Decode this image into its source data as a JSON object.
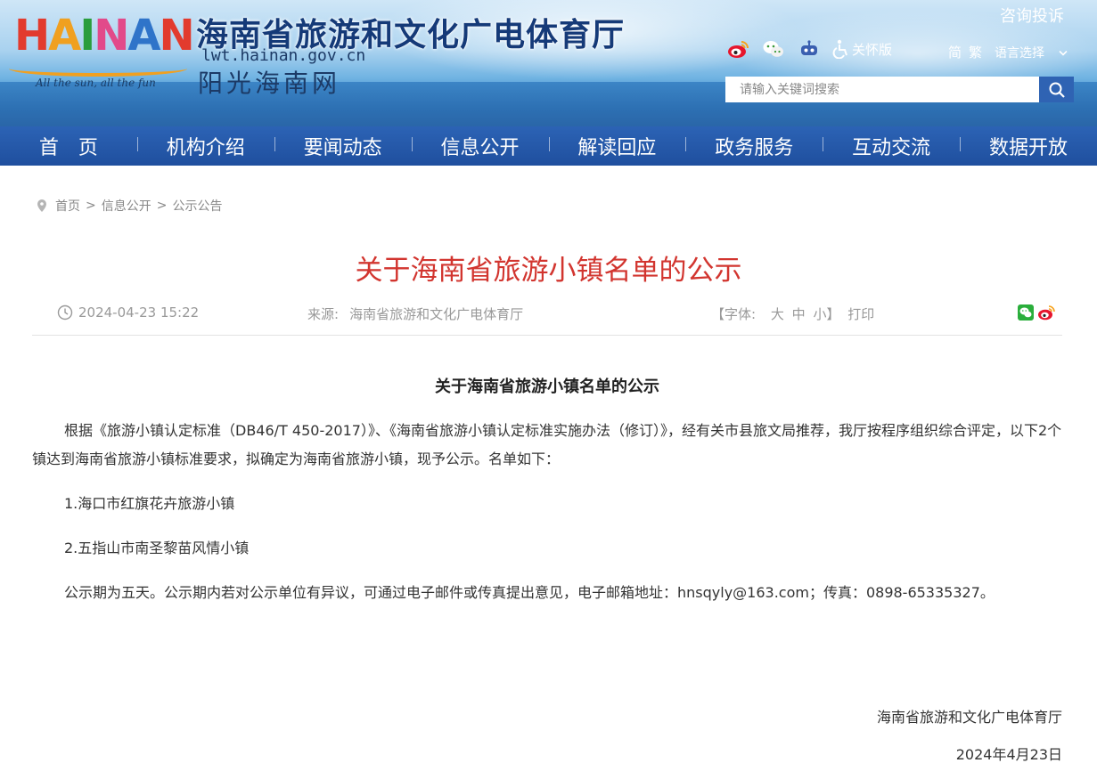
{
  "header": {
    "logo_letters": [
      "H",
      "A",
      "I",
      "N",
      "A",
      "N"
    ],
    "logo_slogan": "All the sun, all the fun",
    "site_title": "海南省旅游和文化广电体育厅",
    "site_domain": "lwt.hainan.gov.cn",
    "site_subtitle": "阳光海南网",
    "consult_link": "咨询投诉",
    "toolbar": {
      "weibo_icon": "weibo-icon",
      "wechat_icon": "wechat-icon",
      "robot_icon": "robot-icon",
      "accessibility_icon": "wheelchair-icon",
      "care_label": "关怀版"
    },
    "lang": {
      "simplified": "简",
      "traditional": "繁",
      "select_label": "语言选择"
    },
    "search": {
      "placeholder": "请输入关键词搜索"
    }
  },
  "nav": {
    "items": [
      "首　页",
      "机构介绍",
      "要闻动态",
      "信息公开",
      "解读回应",
      "政务服务",
      "互动交流",
      "数据开放"
    ]
  },
  "breadcrumb": {
    "items": [
      "首页",
      "信息公开",
      "公示公告"
    ],
    "separator": ">"
  },
  "page_title": "关于海南省旅游小镇名单的公示",
  "meta": {
    "date": "2024-04-23 15:22",
    "source_label": "来源:",
    "source_value": "海南省旅游和文化广电体育厅",
    "font_open": "【字体:",
    "font_large": "大",
    "font_medium": "中",
    "font_small": "小】",
    "print": "打印"
  },
  "article": {
    "title": "关于海南省旅游小镇名单的公示",
    "paragraphs": [
      "根据《旅游小镇认定标准（DB46/T 450-2017）》、《海南省旅游小镇认定标准实施办法（修订）》，经有关市县旅文局推荐，我厅按程序组织综合评定，以下2个镇达到海南省旅游小镇标准要求，拟确定为海南省旅游小镇，现予公示。名单如下：",
      "1.海口市红旗花卉旅游小镇",
      "2.五指山市南圣黎苗风情小镇",
      "公示期为五天。公示期内若对公示单位有异议，可通过电子邮件或传真提出意见，电子邮箱地址：hnsqyly@163.com；传真：0898-65335327。"
    ],
    "signature_org": "海南省旅游和文化广电体育厅",
    "signature_date": "2024年4月23日"
  },
  "colors": {
    "nav_bg": "#2558a8",
    "title_red": "#d2352f",
    "search_btn": "#2f63b3"
  }
}
